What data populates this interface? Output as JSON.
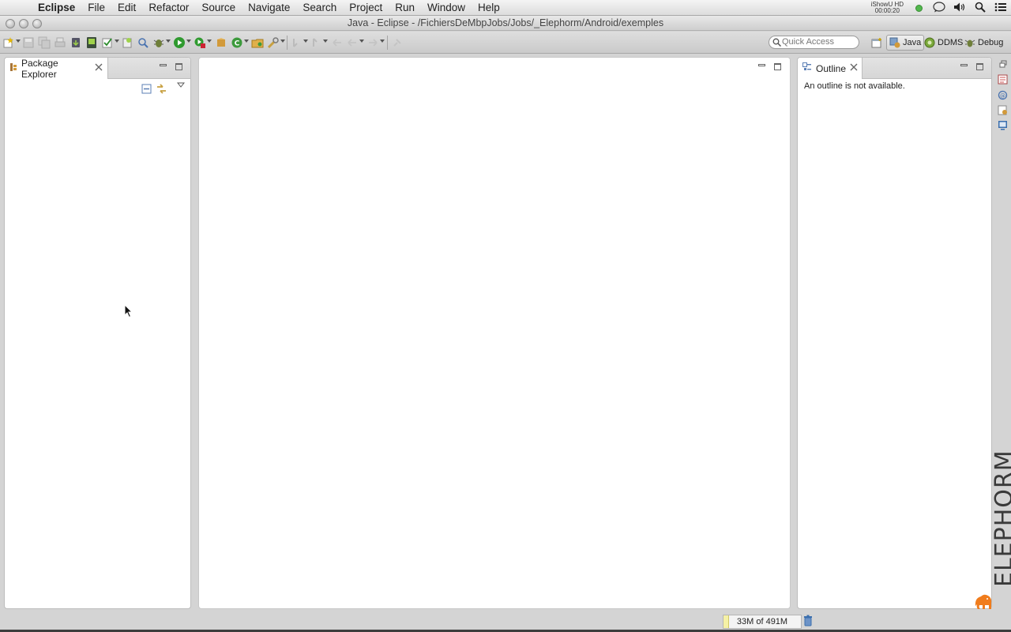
{
  "menubar": {
    "app_name": "Eclipse",
    "items": [
      "File",
      "Edit",
      "Refactor",
      "Source",
      "Navigate",
      "Search",
      "Project",
      "Run",
      "Window",
      "Help"
    ],
    "recorder_name": "iShowU HD",
    "recorder_time": "00:00:20"
  },
  "window": {
    "title": "Java - Eclipse - /FichiersDeMbpJobs/Jobs/_Elephorm/Android/exemples"
  },
  "toolbar": {
    "quick_access_placeholder": "Quick Access",
    "perspectives": [
      {
        "label": "Java",
        "active": true
      },
      {
        "label": "DDMS",
        "active": false
      },
      {
        "label": "Debug",
        "active": false
      }
    ]
  },
  "package_explorer": {
    "tab_label": "Package Explorer"
  },
  "outline": {
    "tab_label": "Outline",
    "message": "An outline is not available."
  },
  "status": {
    "heap_label": "33M of 491M",
    "heap_used_fraction": 0.067
  },
  "watermark": {
    "brand": "ELEPHORM"
  },
  "colors": {
    "accent_run": "#2f9a2f",
    "watermark_logo": "#f07c1c"
  }
}
